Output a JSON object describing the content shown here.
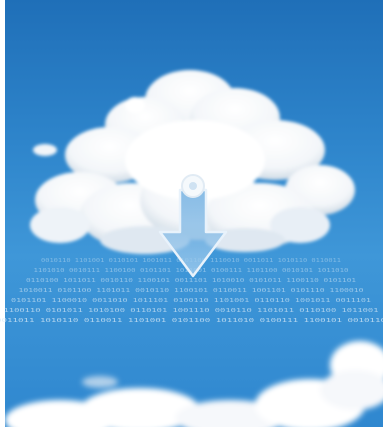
{
  "scene": {
    "description_tag": "cloud-download",
    "colors": {
      "sky_top": "#1f6fb8",
      "sky_mid": "#3f97d8",
      "cloud": "#ffffff",
      "cloud_shadow": "#c9d6e2",
      "arrow_fill": "#9cc7ea",
      "arrow_stroke": "#e8f2fb",
      "binary_text": "#d8eaf8"
    },
    "binary_rows": [
      "0010110 1101001 0110101 1001011 0101100 1110010 0011011 1010110 0110011",
      "1101010 0010111 1100100 0101101 1011001 0100111 1101100 0010101 1011010",
      "0110100 1011011 0010110 1100101 0011101 1010010 0101011 1100110 0101101",
      "1010011 0101100 1101011 0010110 1100101 0110011 1001101 0101110 1100010",
      "0101101 1100010 0011010 1011101 0100110 1101001 0110110 1001011 0011101",
      "1100110 0101011 1010100 0110101 1001110 0010110 1101011 0110100 1011001",
      "0011011 1010110 0110011 1101001 0101100 1011010 0100111 1100101 0010110"
    ]
  }
}
